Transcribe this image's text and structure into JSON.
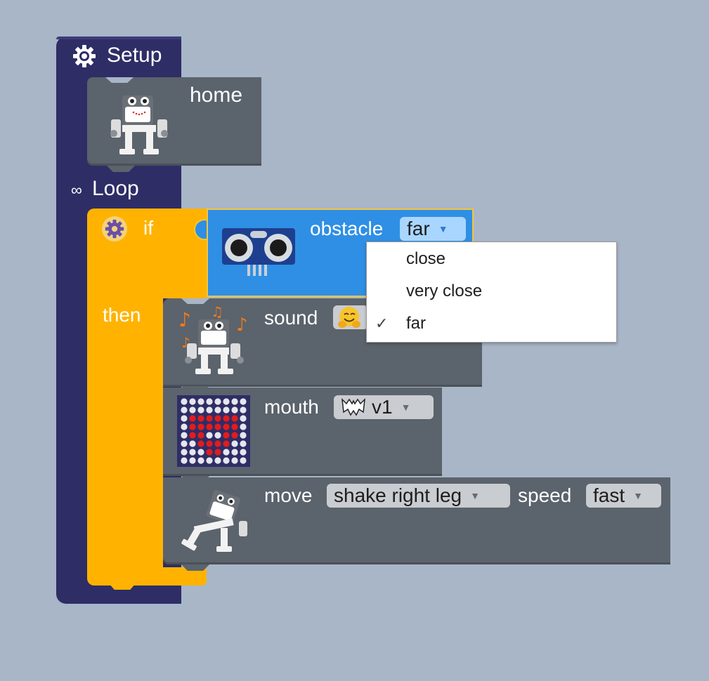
{
  "workspace": {
    "setup_label": "Setup",
    "loop_label": "Loop"
  },
  "home_block": {
    "label": "home"
  },
  "if_block": {
    "if_label": "if",
    "then_label": "then"
  },
  "obstacle_block": {
    "label": "obstacle",
    "selected": "far"
  },
  "dropdown_menu": {
    "items": [
      {
        "label": "close",
        "checked": false
      },
      {
        "label": "very close",
        "checked": false
      },
      {
        "label": "far",
        "checked": true
      }
    ],
    "check_mark": "✓"
  },
  "sound_block": {
    "label": "sound",
    "selected_icon": "hugging-face-emoji"
  },
  "mouth_block": {
    "label": "mouth",
    "selected": "v1",
    "selected_icon": "bat-icon"
  },
  "move_block": {
    "label": "move",
    "action": "shake right leg",
    "speed_label": "speed",
    "speed": "fast"
  },
  "colors": {
    "background": "#a8b6c8",
    "program": "#2e2d66",
    "statement": "#5b636c",
    "logic": "#ffb300",
    "sensor": "#2f8fe4"
  }
}
